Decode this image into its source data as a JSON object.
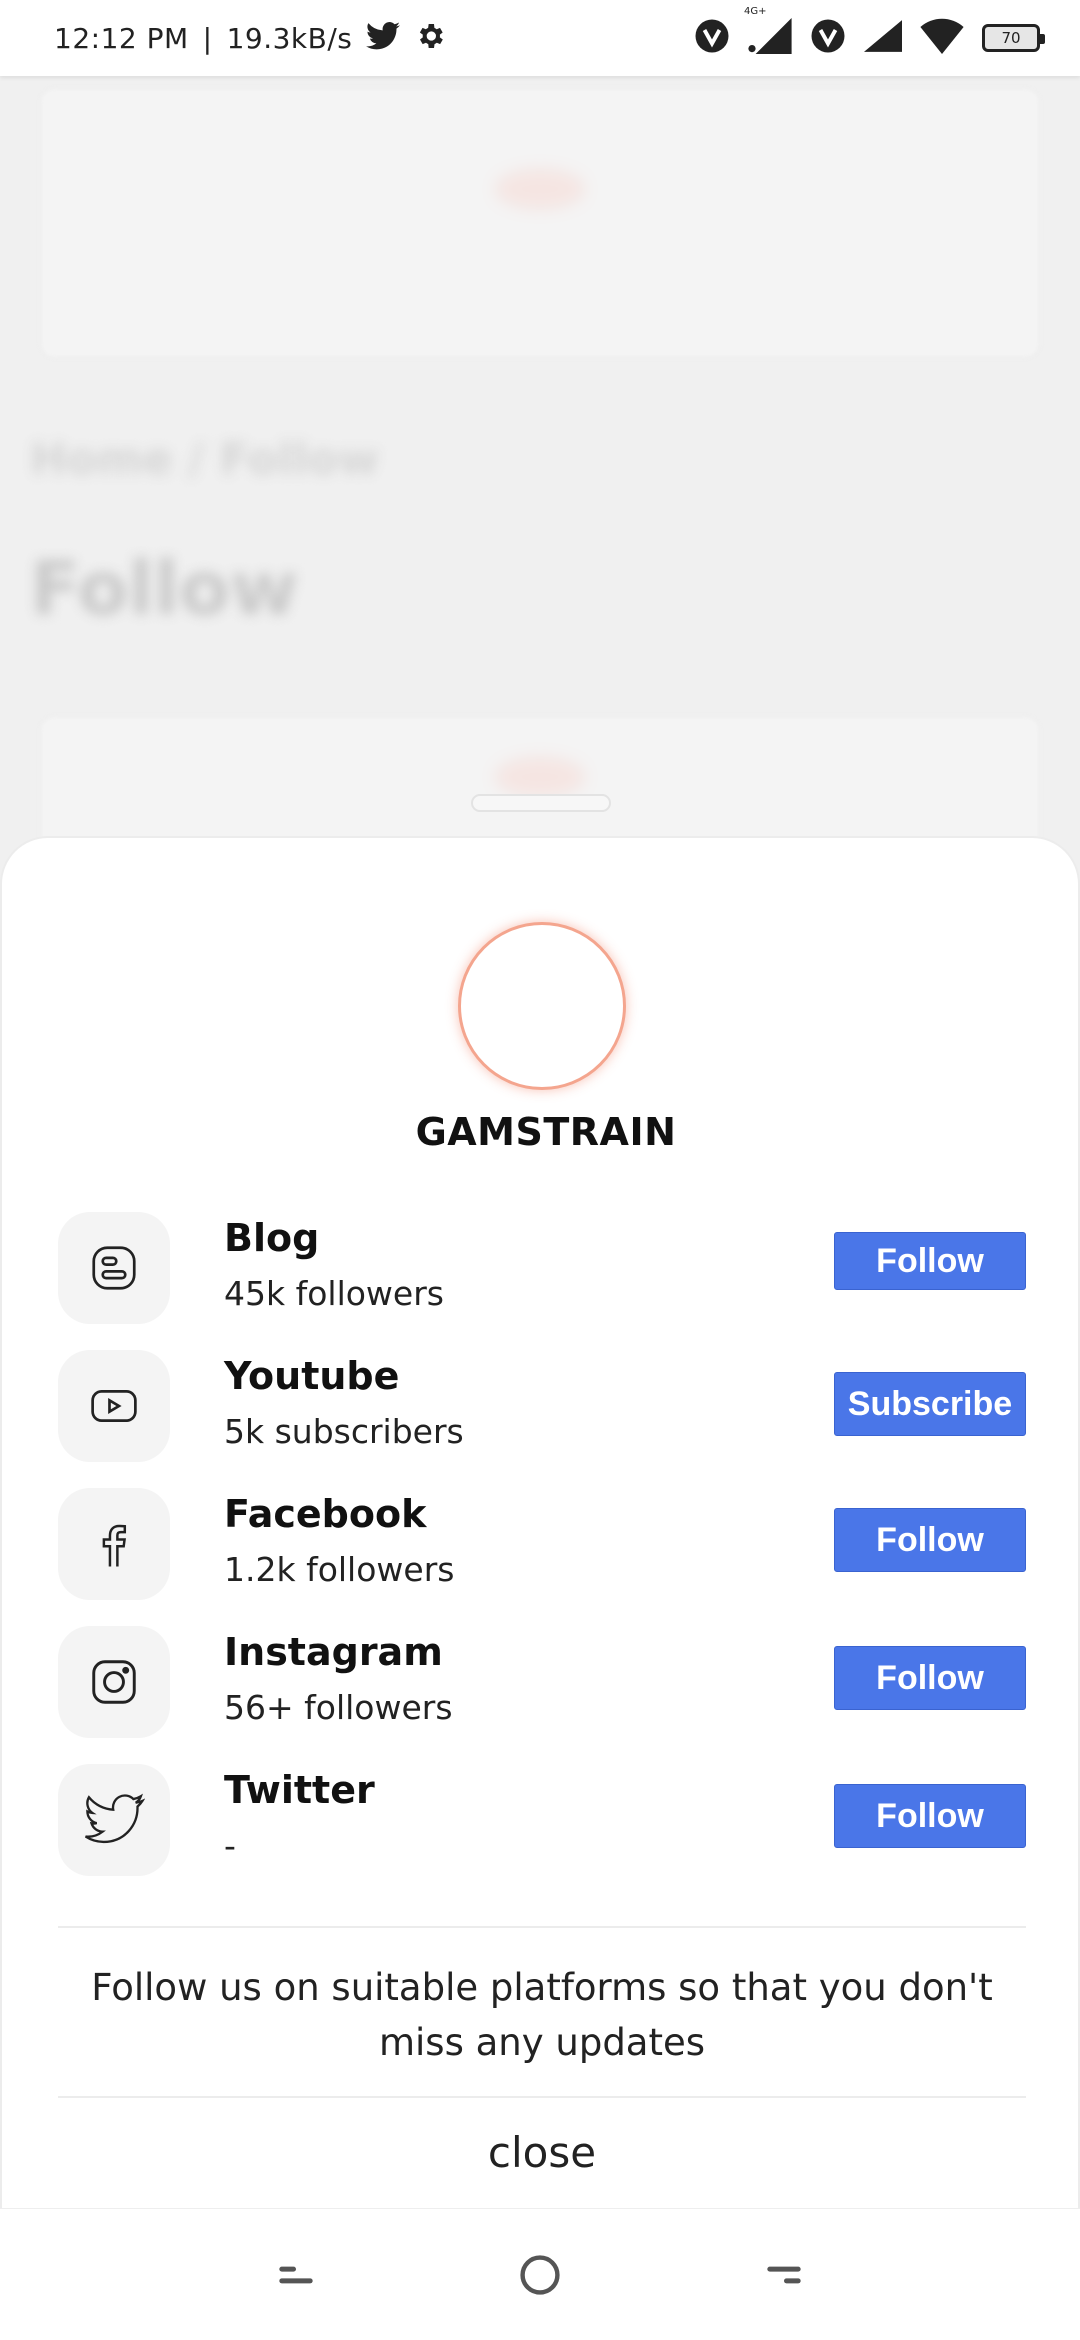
{
  "status_bar": {
    "time": "12:12 PM",
    "separator": "|",
    "speed": "19.3kB/s",
    "network_label": "4G+",
    "battery": "70"
  },
  "background_page": {
    "breadcrumb": "Home / Follow",
    "heading": "Follow"
  },
  "sheet": {
    "brand": "GAMSTRAIN",
    "accent_color": "#4a76e8",
    "avatar_glow_color": "#f4a58e",
    "platforms": [
      {
        "name": "Blog",
        "count": "45k followers",
        "action": "Follow",
        "icon": "blogger-icon"
      },
      {
        "name": "Youtube",
        "count": "5k subscribers",
        "action": "Subscribe",
        "icon": "youtube-icon"
      },
      {
        "name": "Facebook",
        "count": "1.2k followers",
        "action": "Follow",
        "icon": "facebook-icon"
      },
      {
        "name": "Instagram",
        "count": "56+ followers",
        "action": "Follow",
        "icon": "instagram-icon"
      },
      {
        "name": "Twitter",
        "count": "-",
        "action": "Follow",
        "icon": "twitter-icon"
      }
    ],
    "note": "Follow us on suitable platforms so that you don't miss any updates",
    "close_label": "close"
  }
}
